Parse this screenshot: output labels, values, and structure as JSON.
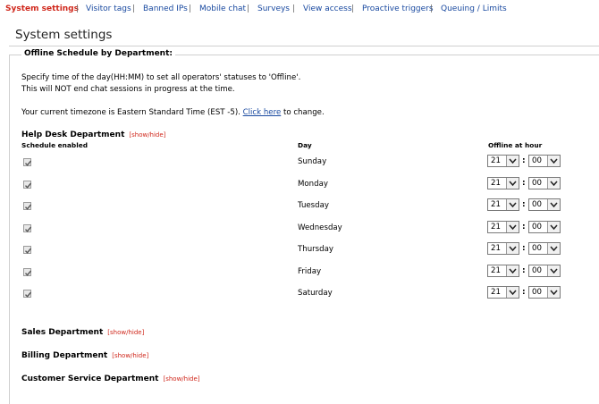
{
  "nav": {
    "items": [
      {
        "label": "System settings",
        "active": true
      },
      {
        "label": "Visitor tags"
      },
      {
        "label": "Banned IPs"
      },
      {
        "label": "Mobile chat"
      },
      {
        "label": "Surveys"
      },
      {
        "label": "View access"
      },
      {
        "label": "Proactive triggers"
      },
      {
        "label": "Queuing / Limits"
      }
    ],
    "separator": "|"
  },
  "page": {
    "title": "System settings",
    "section_title": "Offline Schedule by Department:",
    "intro_line1": "Specify time of the day(HH:MM) to set all operators' statuses to 'Offline'.",
    "intro_line2": "This will NOT end chat sessions in progress at the time.",
    "timezone_prefix": "Your current timezone is Eastern Standard Time (EST -5).",
    "timezone_link": "Click here",
    "timezone_suffix": "to change."
  },
  "schedule": {
    "department": "Help Desk Department",
    "toggle": "[show/hide]",
    "col_enabled": "Schedule enabled",
    "col_day": "Day",
    "col_offline": "Offline at hour",
    "colon": ":",
    "rows": [
      {
        "day": "Sunday",
        "hour": "21",
        "minute": "00",
        "enabled": true
      },
      {
        "day": "Monday",
        "hour": "21",
        "minute": "00",
        "enabled": true
      },
      {
        "day": "Tuesday",
        "hour": "21",
        "minute": "00",
        "enabled": true
      },
      {
        "day": "Wednesday",
        "hour": "21",
        "minute": "00",
        "enabled": true
      },
      {
        "day": "Thursday",
        "hour": "21",
        "minute": "00",
        "enabled": true
      },
      {
        "day": "Friday",
        "hour": "21",
        "minute": "00",
        "enabled": true
      },
      {
        "day": "Saturday",
        "hour": "21",
        "minute": "00",
        "enabled": true
      }
    ]
  },
  "other_departments": [
    {
      "name": "Sales Department",
      "toggle": "[show/hide]"
    },
    {
      "name": "Billing Department",
      "toggle": "[show/hide]"
    },
    {
      "name": "Customer Service Department",
      "toggle": "[show/hide]"
    }
  ],
  "colors": {
    "accent_red": "#d0281c",
    "link_blue": "#1a4aa0"
  },
  "icons": {
    "checkbox": "checkmark-icon",
    "dropdown": "chevron-down-icon"
  }
}
